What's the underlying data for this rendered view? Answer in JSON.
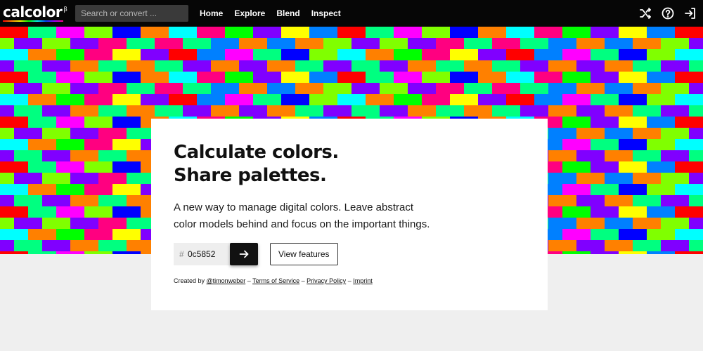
{
  "app": {
    "logo_text": "calcolor",
    "logo_superscript": "β"
  },
  "header": {
    "search": {
      "placeholder": "Search or convert ...",
      "value": ""
    },
    "nav": [
      {
        "label": "Home"
      },
      {
        "label": "Explore"
      },
      {
        "label": "Blend"
      },
      {
        "label": "Inspect"
      }
    ],
    "icons": [
      "shuffle-icon",
      "help-icon",
      "login-icon"
    ]
  },
  "hero": {
    "headline_line1": "Calculate colors.",
    "headline_line2": "Share palettes.",
    "description_line1": "A new way to manage digital colors. Leave abstract",
    "description_line2": "color models behind and focus on the important things.",
    "color_input": {
      "hash": "#",
      "value": "0c5852"
    },
    "go_button_icon": "arrow-right-icon",
    "features_button_label": "View features",
    "footer": {
      "created_by": "Created by",
      "author": "@timonweber",
      "sep": "–",
      "terms": "Terms of Service",
      "privacy": "Privacy Policy",
      "imprint": "Imprint"
    }
  },
  "mosaic": {
    "palette": [
      "#ff0000",
      "#ff8000",
      "#ffff00",
      "#80ff00",
      "#00ff00",
      "#00ff80",
      "#00ffff",
      "#0080ff",
      "#0000ff",
      "#8000ff",
      "#ff00ff",
      "#ff0080"
    ]
  }
}
